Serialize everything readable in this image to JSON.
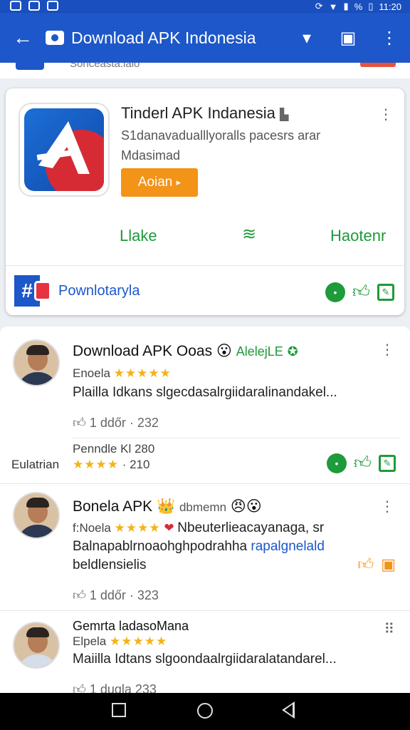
{
  "status_bar": {
    "time": "11:20",
    "battery": "%"
  },
  "app_bar": {
    "title": "Download APK Indonesia"
  },
  "strip": {
    "text": "Sonceasta.lalo"
  },
  "app_card": {
    "name": "Tinderl APK Indanesia",
    "description": "S1danavadualllyoralls pacesrs arar Mdasimad",
    "action_button": "Aoian",
    "tab_left": "Llake",
    "tab_right": "Haotenr",
    "brand_name": "Pownlotaryla"
  },
  "reviews": [
    {
      "title": "Download APK Ooas",
      "tag": "AlelejLE",
      "user": "Enoela",
      "stars": "★★★★★",
      "text": "Plailla Idkans slgecdasalrgiidaralinandakel...",
      "likes": "1 ddőr · 232",
      "sub_name": "Penndle Kl 280",
      "side_label": "Eulatrian",
      "sub_stars": "★★★★",
      "sub_count": "· 210"
    },
    {
      "title": "Bonela APK",
      "tag_small": "dbmemn",
      "user": "f:Noela",
      "stars": "★★★★",
      "inline_text": "Nbeuterlieacayanaga, sr",
      "text_line1": "Balnapablrnoaohghpodrahha",
      "text_link": "rapalgnelald",
      "text_line2": "beldlensielis",
      "likes": "1 ddőr · 323"
    },
    {
      "title": "Gemrta ladasoMana",
      "user": "Elpela",
      "stars": "★★★★★",
      "text": "Maiilla Idtans slgoondaalrgiidaralatandarel...",
      "likes": "1 dugla 233"
    }
  ]
}
